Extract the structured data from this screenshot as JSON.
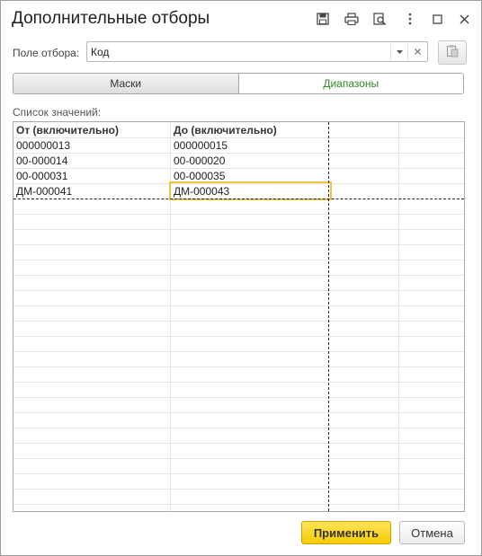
{
  "window": {
    "title": "Дополнительные отборы"
  },
  "titlebar_icons": [
    "save-icon",
    "print-icon",
    "preview-icon",
    "more-icon",
    "maximize-icon",
    "close-icon"
  ],
  "filter_field": {
    "label": "Поле отбора:",
    "value": "Код"
  },
  "tabs": {
    "masks": "Маски",
    "ranges": "Диапазоны",
    "active": "ranges",
    "active_color": "#2e8b20"
  },
  "list": {
    "label": "Список значений:",
    "headers": {
      "from": "От (включительно)",
      "to": "До (включительно)"
    },
    "rows": [
      {
        "from": "000000013",
        "to": "000000015"
      },
      {
        "from": "00-000014",
        "to": "00-000020"
      },
      {
        "from": "00-000031",
        "to": "00-000035"
      },
      {
        "from": "ДМ-000041",
        "to": "ДМ-000043"
      }
    ]
  },
  "buttons": {
    "apply": "Применить",
    "cancel": "Отмена",
    "apply_color": "#f5cc00"
  }
}
